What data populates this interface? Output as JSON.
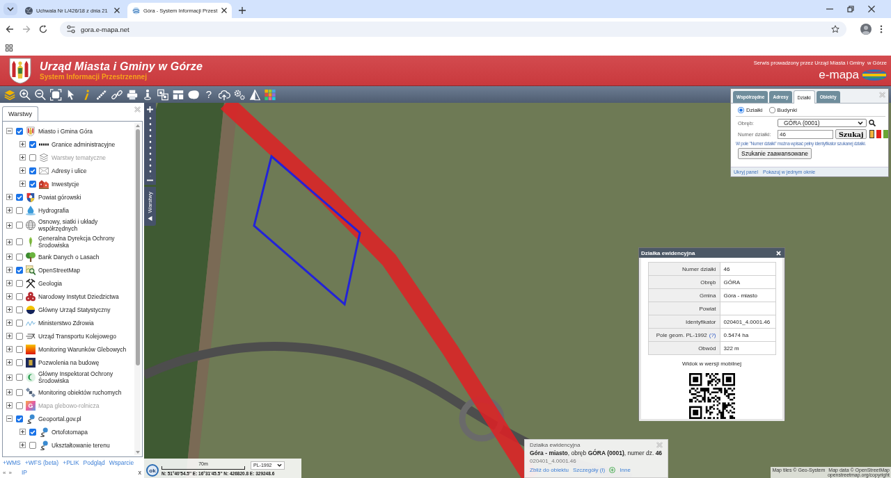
{
  "browser": {
    "tabs": [
      {
        "title": "Uchwala Nr L/426/18 z dnia 21",
        "selected": false
      },
      {
        "title": "Góra - System Informacji Przest",
        "selected": true
      }
    ],
    "url": "gora.e-mapa.net"
  },
  "header": {
    "title": "Urząd Miasta i Gminy w Górze",
    "subtitle": "System Informacji Przestrzennej",
    "operator": "Serwis prowadzony przez Urząd Miasta i Gminy  w Górze",
    "brand": "e-mapa"
  },
  "toolbar": {
    "help": "?"
  },
  "layers_panel": {
    "tab": "Warstwy",
    "items": [
      {
        "label": "Miasto i Gmina Góra",
        "checked": true,
        "expanded": true,
        "disabled": false,
        "children": [
          {
            "label": "Granice administracyjne",
            "checked": true,
            "expanded": false,
            "disabled": false
          },
          {
            "label": "Warstwy tematyczne",
            "checked": false,
            "expanded": false,
            "disabled": true
          },
          {
            "label": "Adresy i ulice",
            "checked": true,
            "expanded": false,
            "disabled": false
          },
          {
            "label": "Inwestycje",
            "checked": true,
            "expanded": false,
            "disabled": false
          }
        ]
      },
      {
        "label": "Powiat górowski",
        "checked": true,
        "expanded": false,
        "disabled": false
      },
      {
        "label": "Hydrografia",
        "checked": false,
        "expanded": false,
        "disabled": false
      },
      {
        "label": "Osnowy, siatki i układy współrzędnych",
        "checked": false,
        "expanded": false,
        "disabled": false
      },
      {
        "label": "Generalna Dyrekcja Ochrony Środowiska",
        "checked": false,
        "expanded": false,
        "disabled": false
      },
      {
        "label": "Bank Danych o Lasach",
        "checked": false,
        "expanded": false,
        "disabled": false
      },
      {
        "label": "OpenStreetMap",
        "checked": true,
        "expanded": false,
        "disabled": false
      },
      {
        "label": "Geologia",
        "checked": false,
        "expanded": false,
        "disabled": false
      },
      {
        "label": "Narodowy Instytut Dziedzictwa",
        "checked": false,
        "expanded": false,
        "disabled": false
      },
      {
        "label": "Główny Urząd Statystyczny",
        "checked": false,
        "expanded": false,
        "disabled": false
      },
      {
        "label": "Ministerstwo Zdrowia",
        "checked": false,
        "expanded": false,
        "disabled": false
      },
      {
        "label": "Urząd Transportu Kolejowego",
        "checked": false,
        "expanded": false,
        "disabled": false
      },
      {
        "label": "Monitoring Warunków Glebowych",
        "checked": false,
        "expanded": false,
        "disabled": false
      },
      {
        "label": "Pozwolenia na budowę",
        "checked": false,
        "expanded": false,
        "disabled": false
      },
      {
        "label": "Główny Inspektorat Ochrony Środowiska",
        "checked": false,
        "expanded": false,
        "disabled": false
      },
      {
        "label": "Monitoring obiektów ruchomych",
        "checked": false,
        "expanded": false,
        "disabled": false
      },
      {
        "label": "Mapa glebowo-rolnicza",
        "checked": false,
        "expanded": false,
        "disabled": true,
        "icon_text": "G"
      },
      {
        "label": "Geoportal.gov.pl",
        "checked": true,
        "expanded": true,
        "disabled": false,
        "children": [
          {
            "label": "Ortofotomapa",
            "checked": true,
            "expanded": false,
            "disabled": false
          },
          {
            "label": "Ukształtowanie terenu",
            "checked": false,
            "expanded": false,
            "disabled": false
          }
        ]
      }
    ],
    "footer_links": [
      "+WMS",
      "+WFS (beta)",
      "+PLIK",
      "Podgląd",
      "Wsparcie"
    ],
    "nav": [
      "«",
      "»"
    ],
    "ip": "IP",
    "close": "x"
  },
  "map": {
    "side_tab": "Warstwy"
  },
  "search_panel": {
    "tabs": [
      {
        "label": "Współrzędne",
        "selected": false
      },
      {
        "label": "Adresy",
        "selected": false
      },
      {
        "label": "Działki",
        "selected": true
      },
      {
        "label": "Obiekty",
        "selected": false
      }
    ],
    "modes": [
      {
        "label": "Działki",
        "selected": true
      },
      {
        "label": "Budynki",
        "selected": false
      }
    ],
    "district_label": "Obręb:",
    "district": "GÓRA (0001)",
    "number_label": "Numer działki:",
    "number": "46",
    "search_button": "Szukaj",
    "highlight_colors": [
      {
        "color": "#f2b33d",
        "selected": true
      },
      {
        "color": "#e3201b",
        "selected": false
      },
      {
        "color": "#6aa536",
        "selected": false
      }
    ],
    "hint": "W pole \"Numer działki\" można wpisać pełny identyfikator szukanej działki.",
    "advanced_button": "Szukanie zaawansowane",
    "links": [
      "Ukryj panel",
      "Pokazuj w jednym oknie"
    ]
  },
  "parcel_popup": {
    "title": "Działka ewidencyjna",
    "rows": [
      {
        "label": "Numer działki",
        "value": "46"
      },
      {
        "label": "Obręb",
        "value": "GÓRA"
      },
      {
        "label": "Gmina",
        "value": "Góra - miasto"
      },
      {
        "label": "Powiat"
      },
      {
        "label": "Identyfikator",
        "value": "020401_4.0001.46"
      },
      {
        "label": "Pole geom. PL-1992",
        "help": "(?)",
        "value": "0.5474 ha"
      },
      {
        "label": "Obwód",
        "value": "322 m"
      }
    ],
    "mobile_caption": "Widok w wersji mobilnej"
  },
  "info_popup": {
    "title": "Działka ewidencyjna",
    "summary": "**Góra - miasto**, obręb **GÓRA (0001)**, numer dz. **46**",
    "identifier": "020401_4.0001.46",
    "links": [
      {
        "label": "Zbliż do obiektu",
        "kind": "link"
      },
      {
        "label": "Szczegóły (I)",
        "kind": "link"
      },
      {
        "label": "Inne",
        "kind": "add"
      }
    ]
  },
  "scale_bar": {
    "distance": "70m",
    "projection": "PL-1992",
    "ok": "ok",
    "coordinates": "N: 51°40'54.5'' E: 16°31'45.5'' N: 426820.8 E: 329248.6"
  },
  "attribution": {
    "tiles": "Map tiles © Geo-System",
    "data": "Map data © OpenStreetMap",
    "link": "openstreetmap.org/copyright"
  }
}
